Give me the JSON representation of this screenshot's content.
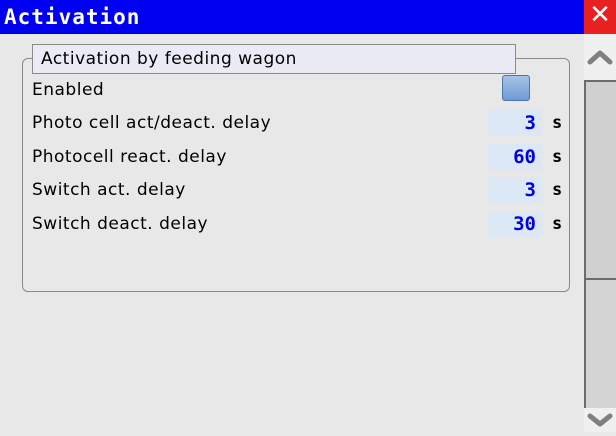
{
  "window": {
    "title": "Activation",
    "close_glyph": "✕"
  },
  "group": {
    "title": "Activation by feeding wagon"
  },
  "settings": {
    "enabled": {
      "label": "Enabled",
      "checked": false
    },
    "rows": [
      {
        "label": "Photo cell act/deact. delay",
        "value": "3",
        "unit": "s"
      },
      {
        "label": "Photocell react. delay",
        "value": "60",
        "unit": "s"
      },
      {
        "label": "Switch act. delay",
        "value": "3",
        "unit": "s"
      },
      {
        "label": "Switch deact. delay",
        "value": "30",
        "unit": "s"
      }
    ]
  },
  "icons": {
    "close": "close-icon",
    "scroll_up": "chevron-up-icon",
    "scroll_down": "chevron-down-icon"
  },
  "colors": {
    "titlebar": "#0000f0",
    "close": "#e82020",
    "value_text": "#0000e0",
    "value_bg": "#dde8f6"
  }
}
